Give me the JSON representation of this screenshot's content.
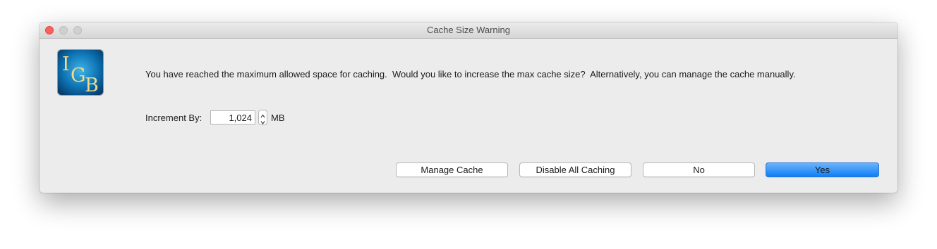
{
  "window": {
    "title": "Cache Size Warning"
  },
  "logo": {
    "text_top": "I",
    "text_mid": "G",
    "text_bot": "B"
  },
  "message": "You have reached the maximum allowed space for caching.  Would you like to increase the max cache size?  Alternatively, you can manage the cache manually.",
  "increment": {
    "label": "Increment By:",
    "value": "1,024",
    "unit": "MB"
  },
  "buttons": {
    "manage": "Manage Cache",
    "disable": "Disable All Caching",
    "no": "No",
    "yes": "Yes"
  },
  "colors": {
    "default_button": "#0d7ff5",
    "close_light": "#fc605c"
  }
}
